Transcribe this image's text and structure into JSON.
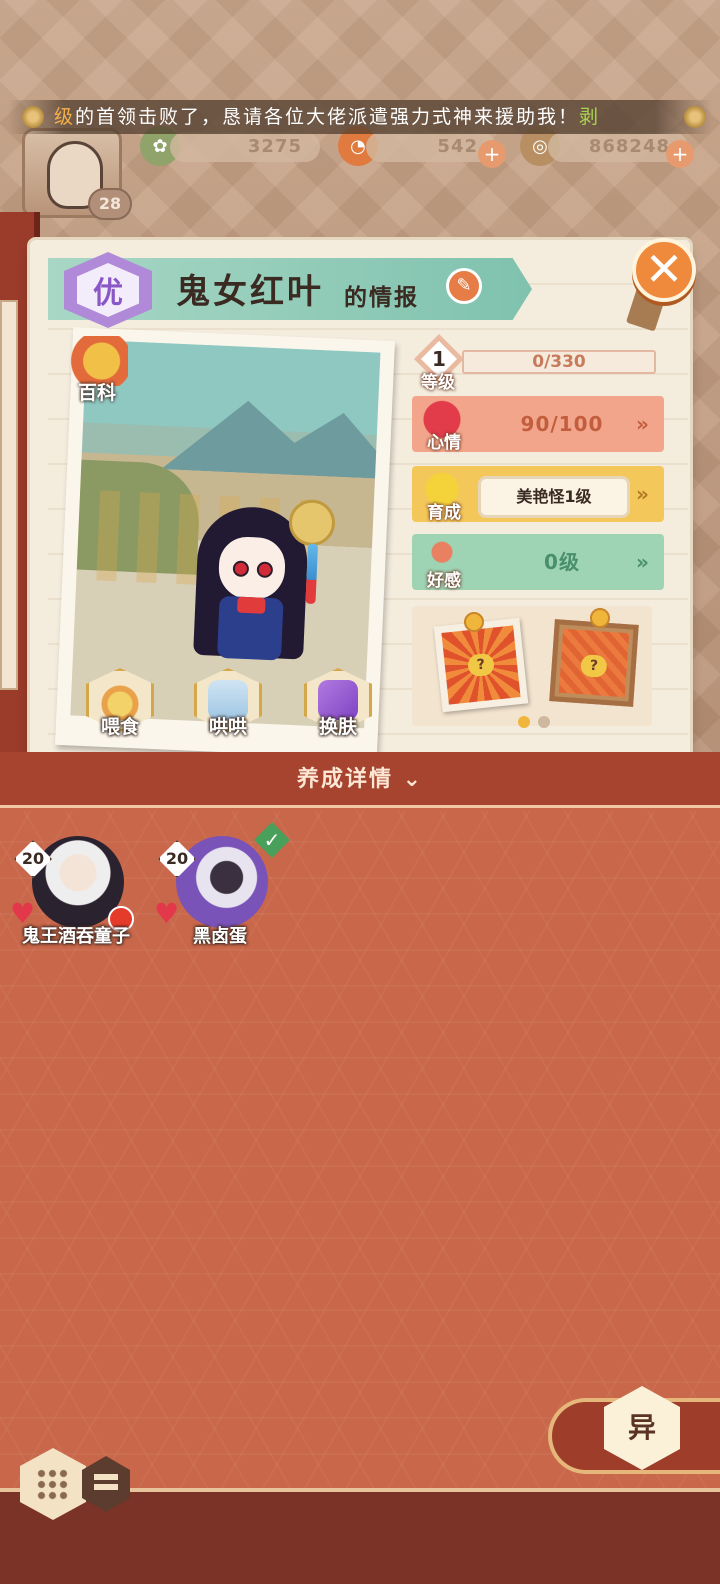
{
  "announcement": {
    "prefix": "级",
    "text": "的首领击败了，恳请各位大佬派遣强力式神来援助我！",
    "suffix": "剥"
  },
  "player": {
    "level": "28"
  },
  "resources": {
    "stamina": "3275",
    "magatama": "542",
    "gold": "868248"
  },
  "info": {
    "rarity": "优",
    "name": "鬼女红叶",
    "title_suffix": "的情报"
  },
  "photo_buttons": {
    "encyclopedia": "百科",
    "feed": "喂食",
    "coax": "哄哄",
    "change_skin": "换肤"
  },
  "stats": {
    "level_label": "等级",
    "level_value": "1",
    "exp": "0/330",
    "mood_label": "心情",
    "mood_value": "90/100",
    "growth_label": "育成",
    "growth_value": "美艳怪1级",
    "affinity_label": "好感",
    "affinity_value": "0级"
  },
  "album": {
    "frame1_mark": "?",
    "frame2_mark": "?"
  },
  "details_header": "养成详情",
  "shikigami": [
    {
      "level": "20",
      "name": "鬼王酒吞童子",
      "has_alert": true,
      "selected": false
    },
    {
      "level": "20",
      "name": "黑卤蛋",
      "has_alert": false,
      "selected": true
    }
  ],
  "bottom": {
    "special_button": "异"
  },
  "colors": {
    "background": "#c9674a",
    "mood": "#f2a58a",
    "growth": "#f4c75a",
    "affinity": "#9ed3b4",
    "title_ribbon": "#7fc2ae"
  }
}
